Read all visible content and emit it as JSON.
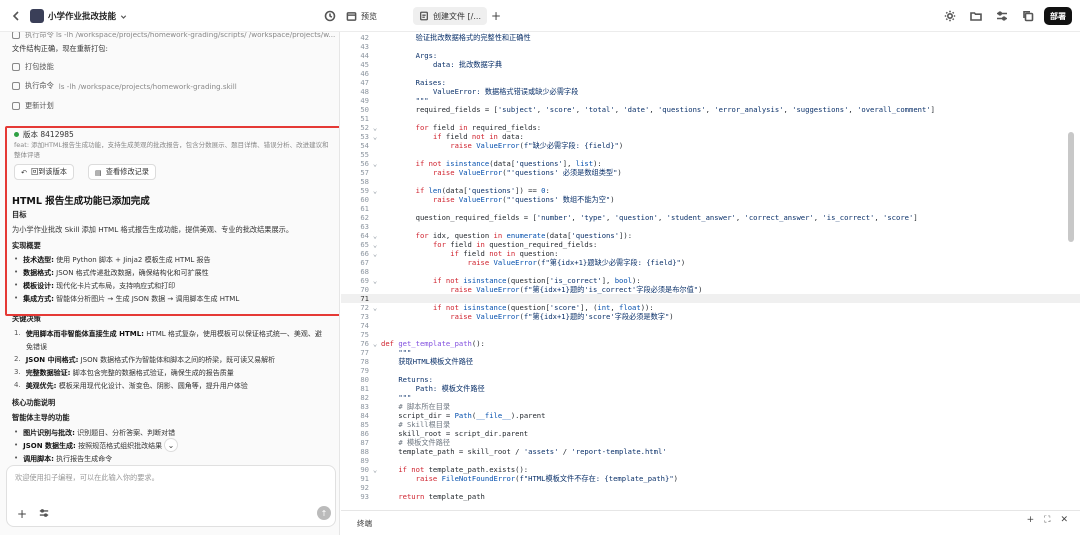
{
  "topbar": {
    "title": "小学作业批改技能",
    "preview_label": "预览",
    "file_tab_label": "创建文件 [/...",
    "deploy_label": "部署"
  },
  "chat": {
    "cmd_row1": "执行命令 ls -lh /workspace/projects/homework-grading/scripts/ /workspace/projects/w...",
    "structure_ok": "文件结构正确，现在重新打包:",
    "step_pack": "打包技能",
    "cmd_row2_label": "执行命令",
    "cmd_row2_cmd": "ls -lh /workspace/projects/homework-grading.skill",
    "step_update": "更新计划",
    "version_label": "版本 8412985",
    "version_desc": "feat: 添加HTML报告生成功能，支持生成美观的批改报告，包含分数展示、题目详情、错误分析、改进建议和整体评语",
    "rollback_label": "回到该版本",
    "history_label": "查看修改记录",
    "heading": "HTML 报告生成功能已添加完成",
    "goal_title": "目标",
    "goal_text": "为小学作业批改 Skill 添加 HTML 格式报告生成功能，提供美观、专业的批改结果展示。",
    "impl_title": "实现概要",
    "impl_items": [
      {
        "bold": "技术选型:",
        "text": "使用 Python 脚本 + Jinja2 模板生成 HTML 报告"
      },
      {
        "bold": "数据格式:",
        "text": "JSON 格式传递批改数据，确保结构化和可扩展性"
      },
      {
        "bold": "模板设计:",
        "text": "现代化卡片式布局，支持响应式和打印"
      },
      {
        "bold": "集成方式:",
        "text": "智能体分析图片 → 生成 JSON 数据 → 调用脚本生成 HTML"
      }
    ],
    "decision_title": "关键决策",
    "decision_items": [
      {
        "num": "1.",
        "bold": "使用脚本而非智能体直接生成 HTML:",
        "text": "HTML 格式复杂，使用模板可以保证格式统一、美观、避"
      },
      {
        "num": "",
        "bold": "",
        "text": "免错误"
      },
      {
        "num": "2.",
        "bold": "JSON 中间格式:",
        "text": "JSON 数据格式作为智能体和脚本之间的桥梁，既可读又易解析"
      },
      {
        "num": "3.",
        "bold": "完整数据验证:",
        "text": "脚本包含完整的数据格式验证，确保生成的报告质量"
      },
      {
        "num": "4.",
        "bold": "美观优先:",
        "text": "模板采用现代化设计、渐变色、阴影、圆角等，提升用户体验"
      }
    ],
    "core_title": "核心功能说明",
    "agent_title": "智能体主导的功能",
    "agent_items": [
      {
        "bold": "图片识别与批改:",
        "text": "识别题目、分析答案、判断对错"
      },
      {
        "bold": "JSON 数据生成:",
        "text": "按照规范格式组织批改结果"
      },
      {
        "bold": "调用脚本:",
        "text": "执行报告生成命令"
      }
    ],
    "composer_placeholder": "欢迎使用扣子编程，可以在此输入你的要求。"
  },
  "editor": {
    "active_line": 71,
    "lines": [
      {
        "n": 42,
        "f": "",
        "h": "        <span class=\"str\">验证批改数据格式的完整性和正确性</span>"
      },
      {
        "n": 43,
        "f": "",
        "h": ""
      },
      {
        "n": 44,
        "f": "",
        "h": "        <span class=\"str\">Args:</span>"
      },
      {
        "n": 45,
        "f": "",
        "h": "            <span class=\"str\">data: 批改数据字典</span>"
      },
      {
        "n": 46,
        "f": "",
        "h": ""
      },
      {
        "n": 47,
        "f": "",
        "h": "        <span class=\"str\">Raises:</span>"
      },
      {
        "n": 48,
        "f": "",
        "h": "            <span class=\"str\">ValueError: 数据格式错误或缺少必需字段</span>"
      },
      {
        "n": 49,
        "f": "",
        "h": "        <span class=\"str\">\"\"\"</span>"
      },
      {
        "n": 50,
        "f": "",
        "h": "        required_fields = [<span class=\"str\">'subject'</span>, <span class=\"str\">'score'</span>, <span class=\"str\">'total'</span>, <span class=\"str\">'date'</span>, <span class=\"str\">'questions'</span>, <span class=\"str\">'error_analysis'</span>, <span class=\"str\">'suggestions'</span>, <span class=\"str\">'overall_comment'</span>]"
      },
      {
        "n": 51,
        "f": "",
        "h": ""
      },
      {
        "n": 52,
        "f": "v",
        "h": "        <span class=\"kw\">for</span> field <span class=\"kw\">in</span> required_fields:"
      },
      {
        "n": 53,
        "f": "v",
        "h": "            <span class=\"kw\">if</span> field <span class=\"kw\">not in</span> data:"
      },
      {
        "n": 54,
        "f": "",
        "h": "                <span class=\"kw\">raise</span> <span class=\"bi\">ValueError</span>(<span class=\"str\">f\"缺少必需字段: {field}\"</span>)"
      },
      {
        "n": 55,
        "f": "",
        "h": ""
      },
      {
        "n": 56,
        "f": "v",
        "h": "        <span class=\"kw\">if not</span> <span class=\"bi\">isinstance</span>(data[<span class=\"str\">'questions'</span>], <span class=\"bi\">list</span>):"
      },
      {
        "n": 57,
        "f": "",
        "h": "            <span class=\"kw\">raise</span> <span class=\"bi\">ValueError</span>(<span class=\"str\">\"'questions' 必须是数组类型\"</span>)"
      },
      {
        "n": 58,
        "f": "",
        "h": ""
      },
      {
        "n": 59,
        "f": "v",
        "h": "        <span class=\"kw\">if</span> <span class=\"bi\">len</span>(data[<span class=\"str\">'questions'</span>]) == <span class=\"bi\">0</span>:"
      },
      {
        "n": 60,
        "f": "",
        "h": "            <span class=\"kw\">raise</span> <span class=\"bi\">ValueError</span>(<span class=\"str\">\"'questions' 数组不能为空\"</span>)"
      },
      {
        "n": 61,
        "f": "",
        "h": ""
      },
      {
        "n": 62,
        "f": "",
        "h": "        question_required_fields = [<span class=\"str\">'number'</span>, <span class=\"str\">'type'</span>, <span class=\"str\">'question'</span>, <span class=\"str\">'student_answer'</span>, <span class=\"str\">'correct_answer'</span>, <span class=\"str\">'is_correct'</span>, <span class=\"str\">'score'</span>]"
      },
      {
        "n": 63,
        "f": "",
        "h": ""
      },
      {
        "n": 64,
        "f": "v",
        "h": "        <span class=\"kw\">for</span> idx, question <span class=\"kw\">in</span> <span class=\"bi\">enumerate</span>(data[<span class=\"str\">'questions'</span>]):"
      },
      {
        "n": 65,
        "f": "v",
        "h": "            <span class=\"kw\">for</span> field <span class=\"kw\">in</span> question_required_fields:"
      },
      {
        "n": 66,
        "f": "v",
        "h": "                <span class=\"kw\">if</span> field <span class=\"kw\">not in</span> question:"
      },
      {
        "n": 67,
        "f": "",
        "h": "                    <span class=\"kw\">raise</span> <span class=\"bi\">ValueError</span>(<span class=\"str\">f\"第{idx+1}题缺少必需字段: {field}\"</span>)"
      },
      {
        "n": 68,
        "f": "",
        "h": ""
      },
      {
        "n": 69,
        "f": "v",
        "h": "            <span class=\"kw\">if not</span> <span class=\"bi\">isinstance</span>(question[<span class=\"str\">'is_correct'</span>], <span class=\"bi\">bool</span>):"
      },
      {
        "n": 70,
        "f": "",
        "h": "                <span class=\"kw\">raise</span> <span class=\"bi\">ValueError</span>(<span class=\"str\">f\"第{idx+1}题的'is_correct'字段必须是布尔值\"</span>)"
      },
      {
        "n": 71,
        "f": "",
        "h": ""
      },
      {
        "n": 72,
        "f": "v",
        "h": "            <span class=\"kw\">if not</span> <span class=\"bi\">isinstance</span>(question[<span class=\"str\">'score'</span>], (<span class=\"bi\">int</span>, <span class=\"bi\">float</span>)):"
      },
      {
        "n": 73,
        "f": "",
        "h": "                <span class=\"kw\">raise</span> <span class=\"bi\">ValueError</span>(<span class=\"str\">f\"第{idx+1}题的'score'字段必须是数字\"</span>)"
      },
      {
        "n": 74,
        "f": "",
        "h": ""
      },
      {
        "n": 75,
        "f": "",
        "h": ""
      },
      {
        "n": 76,
        "f": "v",
        "h": "<span class=\"kw\">def</span> <span class=\"fn\">get_template_path</span>():"
      },
      {
        "n": 77,
        "f": "",
        "h": "    <span class=\"str\">\"\"\"</span>"
      },
      {
        "n": 78,
        "f": "",
        "h": "    <span class=\"str\">获取HTML模板文件路径</span>"
      },
      {
        "n": 79,
        "f": "",
        "h": ""
      },
      {
        "n": 80,
        "f": "",
        "h": "    <span class=\"str\">Returns:</span>"
      },
      {
        "n": 81,
        "f": "",
        "h": "        <span class=\"str\">Path: 模板文件路径</span>"
      },
      {
        "n": 82,
        "f": "",
        "h": "    <span class=\"str\">\"\"\"</span>"
      },
      {
        "n": 83,
        "f": "",
        "h": "    <span class=\"com\"># 脚本所在目录</span>"
      },
      {
        "n": 84,
        "f": "",
        "h": "    script_dir = <span class=\"bi\">Path</span>(<span class=\"bi\">__file__</span>).parent"
      },
      {
        "n": 85,
        "f": "",
        "h": "    <span class=\"com\"># Skill根目录</span>"
      },
      {
        "n": 86,
        "f": "",
        "h": "    skill_root = script_dir.parent"
      },
      {
        "n": 87,
        "f": "",
        "h": "    <span class=\"com\"># 模板文件路径</span>"
      },
      {
        "n": 88,
        "f": "",
        "h": "    template_path = skill_root / <span class=\"str\">'assets'</span> / <span class=\"str\">'report-template.html'</span>"
      },
      {
        "n": 89,
        "f": "",
        "h": ""
      },
      {
        "n": 90,
        "f": "v",
        "h": "    <span class=\"kw\">if not</span> template_path.exists():"
      },
      {
        "n": 91,
        "f": "",
        "h": "        <span class=\"kw\">raise</span> <span class=\"bi\">FileNotFoundError</span>(<span class=\"str\">f\"HTML模板文件不存在: {template_path}\"</span>)"
      },
      {
        "n": 92,
        "f": "",
        "h": ""
      },
      {
        "n": 93,
        "f": "",
        "h": "    <span class=\"kw\">return</span> template_path"
      }
    ]
  },
  "terminal": {
    "label": "终端"
  }
}
